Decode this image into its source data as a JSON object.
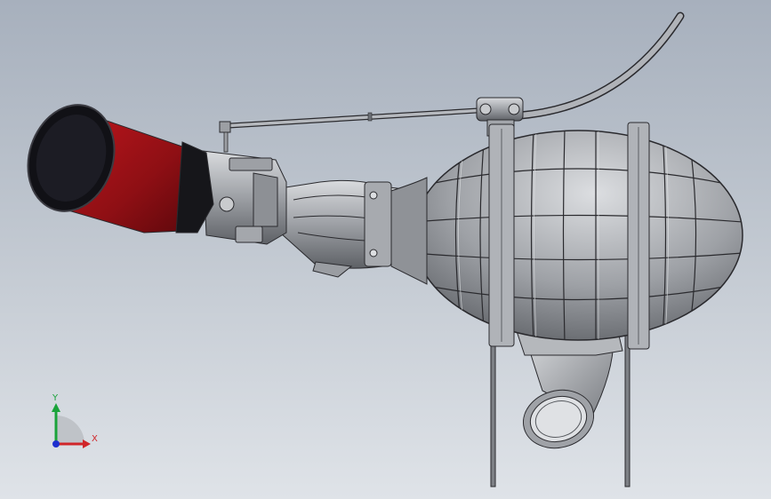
{
  "viewport": {
    "background_top": "#a7b0bd",
    "background_bottom": "#dfe3e8"
  },
  "model": {
    "parts": [
      "air-filter",
      "carburetor-body",
      "intake-manifold",
      "fuel-line-rod",
      "fuel-tank-vessel",
      "mounting-bracket",
      "outlet-elbow-pipe",
      "support-legs"
    ],
    "colors": {
      "air_filter": "#9b1116",
      "filter_cap": "#1b1b22",
      "metal": "#a9acb1",
      "metal_dark": "#6d7076",
      "edge": "#2a2a2e"
    }
  },
  "triad": {
    "x_label": "X",
    "y_label": "Y",
    "x_color": "#d0262a",
    "y_color": "#1aa33a",
    "z_color": "#1d2fcf"
  }
}
